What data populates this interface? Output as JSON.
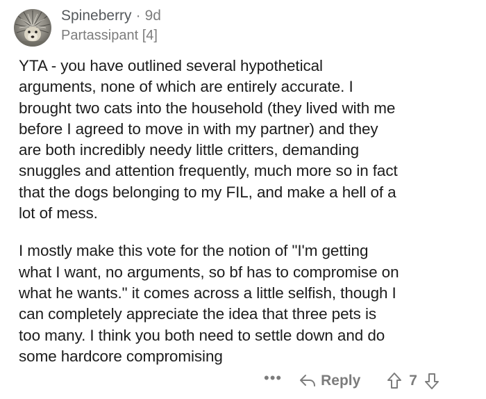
{
  "comment": {
    "username": "Spineberry",
    "separator": "·",
    "age": "9d",
    "flair": "Partassipant [4]",
    "paragraphs": [
      "YTA - you have outlined several hypothetical\narguments, none of which are entirely accurate. I\nbrought two cats into the household (they lived with me\nbefore I agreed to move in with my partner) and they\nare both incredibly needy little critters, demanding\nsnuggles and attention frequently, much more so in fact\nthat the dogs belonging to my FIL, and make a hell of a\nlot of mess.",
      "I mostly make this vote for the notion of \"I'm getting\nwhat I want, no arguments, so bf has to compromise on\nwhat he wants.\" it comes across a little selfish, though I\ncan completely appreciate the idea that three pets is\ntoo many. I think you both need to settle down and do\nsome hardcore compromising"
    ],
    "actions": {
      "more": "•••",
      "reply": "Reply",
      "score": "7"
    }
  },
  "icons": {
    "avatar": "hedgehog-avatar",
    "reply": "reply-arrow-icon",
    "upvote": "upvote-arrow-icon",
    "downvote": "downvote-arrow-icon",
    "more": "more-options-icon"
  },
  "colors": {
    "meta": "#7c7c7c",
    "text": "#1c1c1c"
  }
}
